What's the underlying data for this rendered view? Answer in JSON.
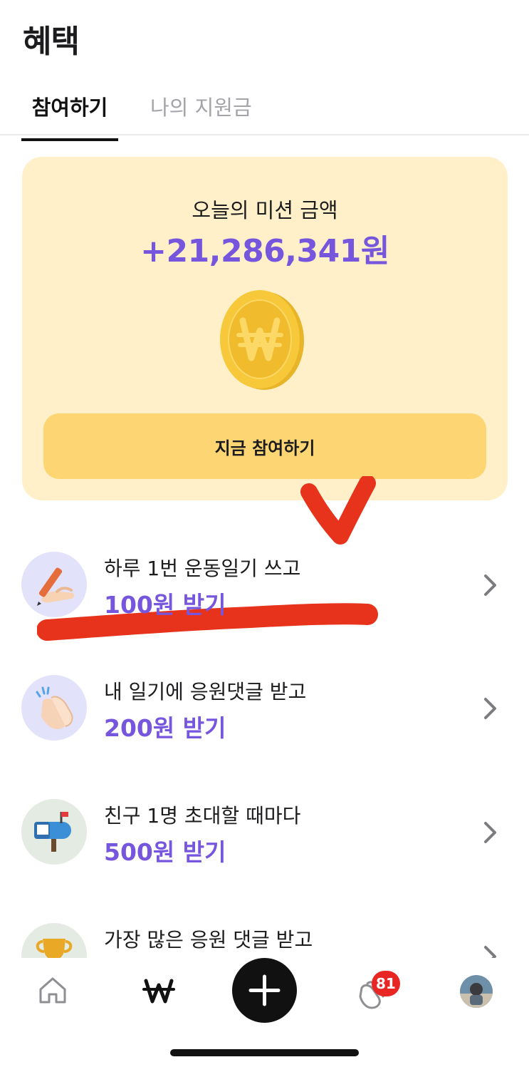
{
  "header": {
    "title": "혜택"
  },
  "tabs": [
    {
      "label": "참여하기",
      "active": true
    },
    {
      "label": "나의 지원금",
      "active": false
    }
  ],
  "mission": {
    "label": "오늘의 미션 금액",
    "amount": "+21,286,341원",
    "coin_icon": "won-coin-icon",
    "button_label": "지금 참여하기"
  },
  "benefits": [
    {
      "title": "하루 1번 운동일기 쓰고",
      "reward": "100원 받기",
      "icon": "pencil-hand-icon"
    },
    {
      "title": "내 일기에 응원댓글 받고",
      "reward": "200원 받기",
      "icon": "clapping-hands-icon"
    },
    {
      "title": "친구 1명 초대할 때마다",
      "reward": "500원 받기",
      "icon": "mailbox-icon"
    },
    {
      "title": "가장 많은 응원 댓글 받고",
      "reward": "",
      "icon": "trophy-icon"
    }
  ],
  "nav": {
    "items": [
      "home-icon",
      "won-icon",
      "add-icon",
      "clap-icon",
      "profile-avatar"
    ],
    "badge": "81"
  },
  "colors": {
    "accent": "#7656dc",
    "card_bg": "#fff0c9",
    "button_bg": "#fdd673",
    "badge": "#e82724",
    "annotation": "#e8331c"
  }
}
